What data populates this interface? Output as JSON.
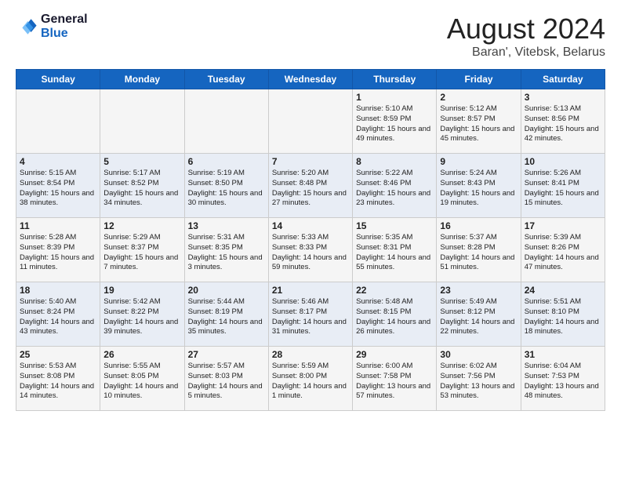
{
  "header": {
    "logo_line1": "General",
    "logo_line2": "Blue",
    "main_title": "August 2024",
    "subtitle": "Baran', Vitebsk, Belarus"
  },
  "days_of_week": [
    "Sunday",
    "Monday",
    "Tuesday",
    "Wednesday",
    "Thursday",
    "Friday",
    "Saturday"
  ],
  "weeks": [
    [
      {
        "day": "",
        "sunrise": "",
        "sunset": "",
        "daylight": ""
      },
      {
        "day": "",
        "sunrise": "",
        "sunset": "",
        "daylight": ""
      },
      {
        "day": "",
        "sunrise": "",
        "sunset": "",
        "daylight": ""
      },
      {
        "day": "",
        "sunrise": "",
        "sunset": "",
        "daylight": ""
      },
      {
        "day": "1",
        "sunrise": "Sunrise: 5:10 AM",
        "sunset": "Sunset: 8:59 PM",
        "daylight": "Daylight: 15 hours and 49 minutes."
      },
      {
        "day": "2",
        "sunrise": "Sunrise: 5:12 AM",
        "sunset": "Sunset: 8:57 PM",
        "daylight": "Daylight: 15 hours and 45 minutes."
      },
      {
        "day": "3",
        "sunrise": "Sunrise: 5:13 AM",
        "sunset": "Sunset: 8:56 PM",
        "daylight": "Daylight: 15 hours and 42 minutes."
      }
    ],
    [
      {
        "day": "4",
        "sunrise": "Sunrise: 5:15 AM",
        "sunset": "Sunset: 8:54 PM",
        "daylight": "Daylight: 15 hours and 38 minutes."
      },
      {
        "day": "5",
        "sunrise": "Sunrise: 5:17 AM",
        "sunset": "Sunset: 8:52 PM",
        "daylight": "Daylight: 15 hours and 34 minutes."
      },
      {
        "day": "6",
        "sunrise": "Sunrise: 5:19 AM",
        "sunset": "Sunset: 8:50 PM",
        "daylight": "Daylight: 15 hours and 30 minutes."
      },
      {
        "day": "7",
        "sunrise": "Sunrise: 5:20 AM",
        "sunset": "Sunset: 8:48 PM",
        "daylight": "Daylight: 15 hours and 27 minutes."
      },
      {
        "day": "8",
        "sunrise": "Sunrise: 5:22 AM",
        "sunset": "Sunset: 8:46 PM",
        "daylight": "Daylight: 15 hours and 23 minutes."
      },
      {
        "day": "9",
        "sunrise": "Sunrise: 5:24 AM",
        "sunset": "Sunset: 8:43 PM",
        "daylight": "Daylight: 15 hours and 19 minutes."
      },
      {
        "day": "10",
        "sunrise": "Sunrise: 5:26 AM",
        "sunset": "Sunset: 8:41 PM",
        "daylight": "Daylight: 15 hours and 15 minutes."
      }
    ],
    [
      {
        "day": "11",
        "sunrise": "Sunrise: 5:28 AM",
        "sunset": "Sunset: 8:39 PM",
        "daylight": "Daylight: 15 hours and 11 minutes."
      },
      {
        "day": "12",
        "sunrise": "Sunrise: 5:29 AM",
        "sunset": "Sunset: 8:37 PM",
        "daylight": "Daylight: 15 hours and 7 minutes."
      },
      {
        "day": "13",
        "sunrise": "Sunrise: 5:31 AM",
        "sunset": "Sunset: 8:35 PM",
        "daylight": "Daylight: 15 hours and 3 minutes."
      },
      {
        "day": "14",
        "sunrise": "Sunrise: 5:33 AM",
        "sunset": "Sunset: 8:33 PM",
        "daylight": "Daylight: 14 hours and 59 minutes."
      },
      {
        "day": "15",
        "sunrise": "Sunrise: 5:35 AM",
        "sunset": "Sunset: 8:31 PM",
        "daylight": "Daylight: 14 hours and 55 minutes."
      },
      {
        "day": "16",
        "sunrise": "Sunrise: 5:37 AM",
        "sunset": "Sunset: 8:28 PM",
        "daylight": "Daylight: 14 hours and 51 minutes."
      },
      {
        "day": "17",
        "sunrise": "Sunrise: 5:39 AM",
        "sunset": "Sunset: 8:26 PM",
        "daylight": "Daylight: 14 hours and 47 minutes."
      }
    ],
    [
      {
        "day": "18",
        "sunrise": "Sunrise: 5:40 AM",
        "sunset": "Sunset: 8:24 PM",
        "daylight": "Daylight: 14 hours and 43 minutes."
      },
      {
        "day": "19",
        "sunrise": "Sunrise: 5:42 AM",
        "sunset": "Sunset: 8:22 PM",
        "daylight": "Daylight: 14 hours and 39 minutes."
      },
      {
        "day": "20",
        "sunrise": "Sunrise: 5:44 AM",
        "sunset": "Sunset: 8:19 PM",
        "daylight": "Daylight: 14 hours and 35 minutes."
      },
      {
        "day": "21",
        "sunrise": "Sunrise: 5:46 AM",
        "sunset": "Sunset: 8:17 PM",
        "daylight": "Daylight: 14 hours and 31 minutes."
      },
      {
        "day": "22",
        "sunrise": "Sunrise: 5:48 AM",
        "sunset": "Sunset: 8:15 PM",
        "daylight": "Daylight: 14 hours and 26 minutes."
      },
      {
        "day": "23",
        "sunrise": "Sunrise: 5:49 AM",
        "sunset": "Sunset: 8:12 PM",
        "daylight": "Daylight: 14 hours and 22 minutes."
      },
      {
        "day": "24",
        "sunrise": "Sunrise: 5:51 AM",
        "sunset": "Sunset: 8:10 PM",
        "daylight": "Daylight: 14 hours and 18 minutes."
      }
    ],
    [
      {
        "day": "25",
        "sunrise": "Sunrise: 5:53 AM",
        "sunset": "Sunset: 8:08 PM",
        "daylight": "Daylight: 14 hours and 14 minutes."
      },
      {
        "day": "26",
        "sunrise": "Sunrise: 5:55 AM",
        "sunset": "Sunset: 8:05 PM",
        "daylight": "Daylight: 14 hours and 10 minutes."
      },
      {
        "day": "27",
        "sunrise": "Sunrise: 5:57 AM",
        "sunset": "Sunset: 8:03 PM",
        "daylight": "Daylight: 14 hours and 5 minutes."
      },
      {
        "day": "28",
        "sunrise": "Sunrise: 5:59 AM",
        "sunset": "Sunset: 8:00 PM",
        "daylight": "Daylight: 14 hours and 1 minute."
      },
      {
        "day": "29",
        "sunrise": "Sunrise: 6:00 AM",
        "sunset": "Sunset: 7:58 PM",
        "daylight": "Daylight: 13 hours and 57 minutes."
      },
      {
        "day": "30",
        "sunrise": "Sunrise: 6:02 AM",
        "sunset": "Sunset: 7:56 PM",
        "daylight": "Daylight: 13 hours and 53 minutes."
      },
      {
        "day": "31",
        "sunrise": "Sunrise: 6:04 AM",
        "sunset": "Sunset: 7:53 PM",
        "daylight": "Daylight: 13 hours and 48 minutes."
      }
    ]
  ]
}
